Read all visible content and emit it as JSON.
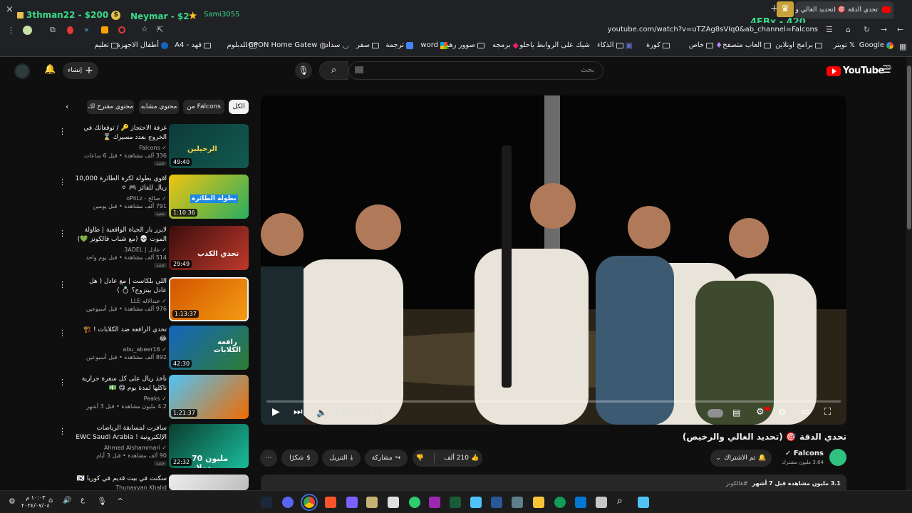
{
  "browser": {
    "tab_title": "تحدي الدقة 🎯 (تحديد الغالي والر...",
    "tab_close": "×",
    "new_tab": "+",
    "url": "youtube.com/watch?v=uTZAg8sVIq0&ab_channel=Falcons",
    "bookmarks": [
      "Google",
      "تويتر",
      "برامج اونلاين",
      "العاب متصفح",
      "خاص",
      "كورة",
      "الذكاء",
      "شيك على الروابط ياحلو",
      "برمجه",
      "صوور رهيبه",
      "word",
      "ترجمة",
      "سفر",
      "سداد",
      "GPON Home Gatew...",
      "الدبلوم",
      "فهد - A4",
      "أطفال الاجهزة",
      "تعليم"
    ]
  },
  "stream_overlay": {
    "donor1": "3thman22 - $200",
    "donor2": "Neymar - $2",
    "donor3": "Sami3055",
    "counter": "4EBx - 420"
  },
  "youtube": {
    "logo_text": "YouTube",
    "logo_region": "SA",
    "search_placeholder": "بحث",
    "create_label": "إنشاء",
    "chips": [
      "الكل",
      "من Falcons",
      "محتوى مشابه",
      "محتوى مقترح لك"
    ],
    "videos": [
      {
        "title": "غرفة الاحتجاز 🔑 / توقعاتك في الخروج بعدد مسيرك ⌛",
        "channel": "Falcons",
        "meta": "336 ألف مشاهدة • قبل 6 ساعات",
        "duration": "49:40",
        "badge": "جديد",
        "thumb_text": "الرحيلين"
      },
      {
        "title": "اقوى بطولة لكرة الطائرة 10,000 ريال للفائز 🎮 ⚪",
        "channel": "صالح - oPiiLz",
        "meta": "791 ألف مشاهدة • قبل يومين",
        "duration": "1:10:36",
        "badge": "جديد",
        "thumb_text": "بطولة الطائرة"
      },
      {
        "title": "لايزر بار الحياة الواقعية | طاولة الموت 💀 (مع شباب فالكونز 💚)",
        "channel": "عادل | 3ADEL",
        "meta": "514 ألف مشاهدة • قبل يوم واحد",
        "duration": "29:49",
        "badge": "جديد",
        "thumb_text": "تحدي الكذب"
      },
      {
        "title": "اللي بلكاست | مع عادل ( هل عادل بيتزوج؟ 💍 )",
        "channel": "عبدالاله LLE",
        "meta": "976 ألف مشاهدة • قبل أسبوعين",
        "duration": "1:13:37",
        "badge": "",
        "thumb_text": ""
      },
      {
        "title": "تحدي الرافعة ضد الكلابات ! 🏗️ 😂",
        "channel": "abu_abeer16",
        "meta": "892 ألف مشاهدة • قبل أسبوعين",
        "duration": "42:30",
        "badge": "",
        "thumb_text": "رافعة الكلابات"
      },
      {
        "title": "نأخذ ريال على كل سعرة حرارية ناكلها لمدة يوم 😋 💵",
        "channel": "Peaks",
        "meta": "4.2 مليون مشاهدة • قبل 3 أشهر",
        "duration": "1:21:37",
        "badge": "",
        "thumb_text": ""
      },
      {
        "title": "سافرت لمسابقة الرياضات الإلكترونية ! EWC Saudi Arabia 🇸🇦",
        "channel": "Ahmed Alshammari",
        "meta": "90 ألف مشاهدة • قبل 3 أيام",
        "duration": "22:32",
        "badge": "جديد",
        "thumb_text": "70 مليون دولار"
      },
      {
        "title": "سكنت في بيت قديم في كوريا 🇰🇷",
        "channel": "Thunayyan Khalid",
        "meta": "",
        "duration": "",
        "badge": "",
        "thumb_text": ""
      }
    ],
    "player": {
      "time": "0:00 / 1:16:34",
      "progress": 0
    },
    "video_title": "تحدي الدقة 🎯 (تحديد الغالي والرخيص)",
    "channel_name": "Falcons",
    "subscribers": "3.64 مليون مشترك",
    "subscribed_label": "تم الاشتراك",
    "likes": "210 ألف",
    "share_label": "مشاركة",
    "download_label": "التنزيل",
    "thanks_label": "شكرًا",
    "description_stats": "3.1 مليون مشاهدة  قبل 7 أشهر",
    "description_tag": "#فالكونز"
  },
  "taskbar": {
    "time": "١٠:٠٣ م",
    "date": "٢٠٢٤/٠٧/٠٤",
    "lang": "ع"
  },
  "colors": {
    "yt_red": "#ff0000",
    "bg": "#0f0f0f",
    "chip": "#272727",
    "overlay_green": "#39d98a",
    "falcons_green": "#2ec27e"
  }
}
